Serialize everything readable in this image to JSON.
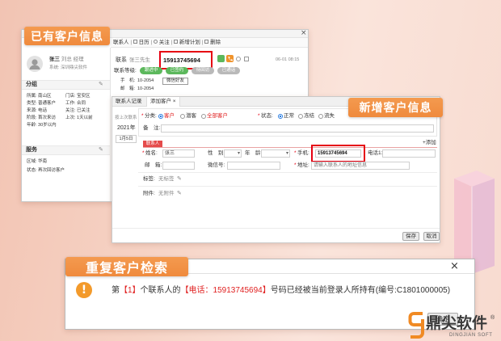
{
  "colors": {
    "callout_orange": "#ef8a3d",
    "highlight_red": "#e60012",
    "warning_orange": "#f39a2b",
    "brand_orange": "#f08a24"
  },
  "callouts": {
    "existing": "已有客户信息",
    "new": "新增客户信息",
    "duplicate": "重复客户检索"
  },
  "existing_window": {
    "close": "×",
    "toolbar": [
      "联系人",
      "日历",
      "关注",
      "新增计划",
      "删除"
    ],
    "profile": {
      "name": "张三",
      "nickname": "刘总",
      "role": "经理",
      "company": "系统: 深圳鼎尖软件"
    },
    "group": {
      "title": "分组",
      "rows": [
        {
          "left": "所属: 南山区",
          "right": "门店: 宝安区"
        },
        {
          "left": "类型: 普通客户",
          "right": "工作: 合同"
        },
        {
          "left": "来源: 电话",
          "right": "关注: 已关注"
        },
        {
          "left": "阶段: 首次来访",
          "right": "上次: 1天以前"
        },
        {
          "left": "年龄: 30岁以内",
          "right": ""
        }
      ]
    },
    "service": {
      "title": "服务",
      "rows": [
        "区域: 华南",
        "状态: 再次回访客户"
      ]
    },
    "contact": {
      "label": "联系",
      "person": "张三先生",
      "phone": "15913745694",
      "time": "06-01 08:15"
    },
    "level": {
      "label": "联系等级:",
      "tags": [
        {
          "text": "跟进中",
          "color": "#5cb85c"
        },
        {
          "text": "已签约",
          "color": "#5cb85c"
        },
        {
          "text": "待回访",
          "color": "#b9b9b9"
        },
        {
          "text": "已通话",
          "color": "#b9b9b9"
        }
      ]
    },
    "mobile": {
      "label": "手　机:",
      "value": "10-2054",
      "wechat": "微信好友"
    },
    "email": {
      "label": "邮　箱:",
      "value": "10-2054"
    }
  },
  "new_window": {
    "tabs": [
      "联系人记录",
      "添加客户 ×"
    ],
    "timeline": {
      "filter": "按上次联系",
      "year": "2021年",
      "date": "1月5日"
    },
    "category": {
      "label": "分类:",
      "options": [
        "客户",
        "潜客",
        "全部客户"
      ],
      "selected": 0
    },
    "status": {
      "label": "状态:",
      "options": [
        "正常",
        "冻结",
        "流失"
      ],
      "selected": 0
    },
    "remark": {
      "label": "备　注:",
      "value": ""
    },
    "contact_tab": "联系人",
    "add_label": "+添加",
    "fields": {
      "name": {
        "label": "姓名:",
        "value": "张三"
      },
      "gender": {
        "label": "性　别:",
        "value": ""
      },
      "age": {
        "label": "年　龄:",
        "value": ""
      },
      "mobile": {
        "label": "手机:",
        "value": "15913745694"
      },
      "phone": {
        "label": "电话1:",
        "value": ""
      },
      "email": {
        "label": "邮　箱:",
        "value": ""
      },
      "wechat": {
        "label": "微信号:",
        "value": ""
      },
      "address": {
        "label": "地址:",
        "value": "请输入联系人的地址信息"
      }
    },
    "tags": {
      "label": "标签:",
      "value": "无标签"
    },
    "attachments": {
      "label": "附件:",
      "value": "无附件"
    },
    "buttons": {
      "save": "保存",
      "cancel": "取消"
    }
  },
  "dialog": {
    "close": "×",
    "message": {
      "p1": "第",
      "p2": "【1】",
      "p3": "个联系人的",
      "p4": "【电话：15913745694】",
      "p5": "号码已经被当前登录人所持有(编号:C1801000005)"
    },
    "ok": "确定"
  },
  "brand": {
    "name": "鼎尖软件",
    "reg": "®",
    "sub": "DINGJIAN SOFT"
  },
  "icons": {
    "avatar": "user-silhouette-icon",
    "edit": "pencil-icon",
    "warning": "exclamation-circle-icon",
    "phone": "phone-icon",
    "app": "green-app-icon",
    "close": "close-icon",
    "logo": "dingjian-logo-icon"
  }
}
